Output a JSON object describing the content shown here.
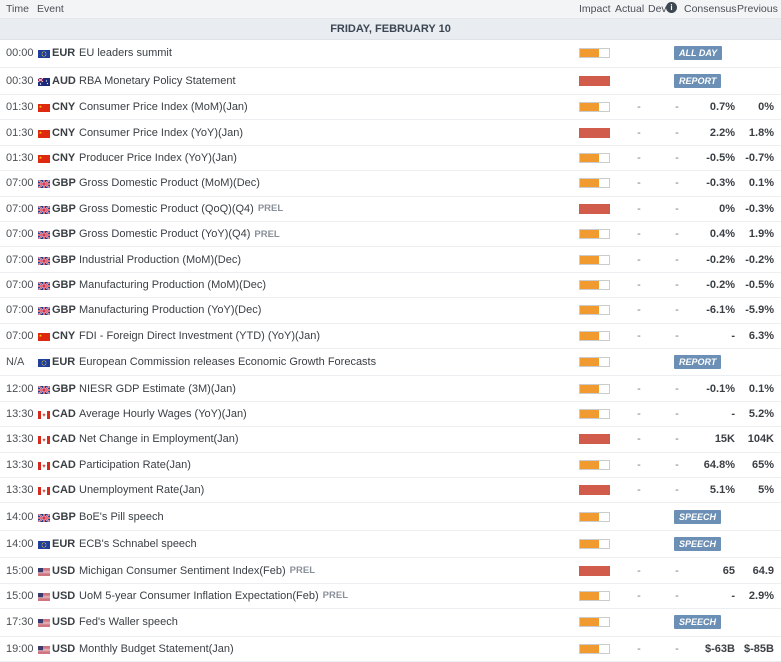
{
  "header": {
    "time": "Time",
    "event": "Event",
    "impact": "Impact",
    "actual": "Actual",
    "dev": "Dev",
    "consensus": "Consensus",
    "previous": "Previous",
    "info_icon": "i"
  },
  "date_label": "FRIDAY, FEBRUARY 10",
  "impact_colors": {
    "medium": "#f09a2f",
    "high": "#d15c4b"
  },
  "events": [
    {
      "time": "00:00",
      "currency": "EUR",
      "flag": "eu-flag",
      "event": "EU leaders summit",
      "tag": "",
      "impact": "medium",
      "actual": "",
      "dev": "",
      "consensus": "",
      "previous": "",
      "badge": "ALL DAY"
    },
    {
      "time": "00:30",
      "currency": "AUD",
      "flag": "au-flag",
      "event": "RBA Monetary Policy Statement",
      "tag": "",
      "impact": "high",
      "actual": "",
      "dev": "",
      "consensus": "",
      "previous": "",
      "badge": "REPORT"
    },
    {
      "time": "01:30",
      "currency": "CNY",
      "flag": "cn-flag",
      "event": "Consumer Price Index (MoM)(Jan)",
      "tag": "",
      "impact": "medium",
      "actual": "-",
      "dev": "-",
      "consensus": "0.7%",
      "previous": "0%",
      "badge": ""
    },
    {
      "time": "01:30",
      "currency": "CNY",
      "flag": "cn-flag",
      "event": "Consumer Price Index (YoY)(Jan)",
      "tag": "",
      "impact": "high",
      "actual": "-",
      "dev": "-",
      "consensus": "2.2%",
      "previous": "1.8%",
      "badge": ""
    },
    {
      "time": "01:30",
      "currency": "CNY",
      "flag": "cn-flag",
      "event": "Producer Price Index (YoY)(Jan)",
      "tag": "",
      "impact": "medium",
      "actual": "-",
      "dev": "-",
      "consensus": "-0.5%",
      "previous": "-0.7%",
      "badge": ""
    },
    {
      "time": "07:00",
      "currency": "GBP",
      "flag": "gb-flag",
      "event": "Gross Domestic Product (MoM)(Dec)",
      "tag": "",
      "impact": "medium",
      "actual": "-",
      "dev": "-",
      "consensus": "-0.3%",
      "previous": "0.1%",
      "badge": ""
    },
    {
      "time": "07:00",
      "currency": "GBP",
      "flag": "gb-flag",
      "event": "Gross Domestic Product (QoQ)(Q4)",
      "tag": "PREL",
      "impact": "high",
      "actual": "-",
      "dev": "-",
      "consensus": "0%",
      "previous": "-0.3%",
      "badge": ""
    },
    {
      "time": "07:00",
      "currency": "GBP",
      "flag": "gb-flag",
      "event": "Gross Domestic Product (YoY)(Q4)",
      "tag": "PREL",
      "impact": "medium",
      "actual": "-",
      "dev": "-",
      "consensus": "0.4%",
      "previous": "1.9%",
      "badge": ""
    },
    {
      "time": "07:00",
      "currency": "GBP",
      "flag": "gb-flag",
      "event": "Industrial Production (MoM)(Dec)",
      "tag": "",
      "impact": "medium",
      "actual": "-",
      "dev": "-",
      "consensus": "-0.2%",
      "previous": "-0.2%",
      "badge": ""
    },
    {
      "time": "07:00",
      "currency": "GBP",
      "flag": "gb-flag",
      "event": "Manufacturing Production (MoM)(Dec)",
      "tag": "",
      "impact": "medium",
      "actual": "-",
      "dev": "-",
      "consensus": "-0.2%",
      "previous": "-0.5%",
      "badge": ""
    },
    {
      "time": "07:00",
      "currency": "GBP",
      "flag": "gb-flag",
      "event": "Manufacturing Production (YoY)(Dec)",
      "tag": "",
      "impact": "medium",
      "actual": "-",
      "dev": "-",
      "consensus": "-6.1%",
      "previous": "-5.9%",
      "badge": ""
    },
    {
      "time": "07:00",
      "currency": "CNY",
      "flag": "cn-flag",
      "event": "FDI - Foreign Direct Investment (YTD) (YoY)(Jan)",
      "tag": "",
      "impact": "medium",
      "actual": "-",
      "dev": "-",
      "consensus": "-",
      "previous": "6.3%",
      "badge": ""
    },
    {
      "time": "N/A",
      "currency": "EUR",
      "flag": "eu-flag",
      "event": "European Commission releases Economic Growth Forecasts",
      "tag": "",
      "impact": "medium",
      "actual": "",
      "dev": "",
      "consensus": "",
      "previous": "",
      "badge": "REPORT"
    },
    {
      "time": "12:00",
      "currency": "GBP",
      "flag": "gb-flag",
      "event": "NIESR GDP Estimate (3M)(Jan)",
      "tag": "",
      "impact": "medium",
      "actual": "-",
      "dev": "-",
      "consensus": "-0.1%",
      "previous": "0.1%",
      "badge": ""
    },
    {
      "time": "13:30",
      "currency": "CAD",
      "flag": "ca-flag",
      "event": "Average Hourly Wages (YoY)(Jan)",
      "tag": "",
      "impact": "medium",
      "actual": "-",
      "dev": "-",
      "consensus": "-",
      "previous": "5.2%",
      "badge": ""
    },
    {
      "time": "13:30",
      "currency": "CAD",
      "flag": "ca-flag",
      "event": "Net Change in Employment(Jan)",
      "tag": "",
      "impact": "high",
      "actual": "-",
      "dev": "-",
      "consensus": "15K",
      "previous": "104K",
      "badge": ""
    },
    {
      "time": "13:30",
      "currency": "CAD",
      "flag": "ca-flag",
      "event": "Participation Rate(Jan)",
      "tag": "",
      "impact": "medium",
      "actual": "-",
      "dev": "-",
      "consensus": "64.8%",
      "previous": "65%",
      "badge": ""
    },
    {
      "time": "13:30",
      "currency": "CAD",
      "flag": "ca-flag",
      "event": "Unemployment Rate(Jan)",
      "tag": "",
      "impact": "high",
      "actual": "-",
      "dev": "-",
      "consensus": "5.1%",
      "previous": "5%",
      "badge": ""
    },
    {
      "time": "14:00",
      "currency": "GBP",
      "flag": "gb-flag",
      "event": "BoE's Pill speech",
      "tag": "",
      "impact": "medium",
      "actual": "",
      "dev": "",
      "consensus": "",
      "previous": "",
      "badge": "SPEECH"
    },
    {
      "time": "14:00",
      "currency": "EUR",
      "flag": "eu-flag",
      "event": "ECB's Schnabel speech",
      "tag": "",
      "impact": "medium",
      "actual": "",
      "dev": "",
      "consensus": "",
      "previous": "",
      "badge": "SPEECH"
    },
    {
      "time": "15:00",
      "currency": "USD",
      "flag": "us-flag",
      "event": "Michigan Consumer Sentiment Index(Feb)",
      "tag": "PREL",
      "impact": "high",
      "actual": "-",
      "dev": "-",
      "consensus": "65",
      "previous": "64.9",
      "badge": ""
    },
    {
      "time": "15:00",
      "currency": "USD",
      "flag": "us-flag",
      "event": "UoM 5-year Consumer Inflation Expectation(Feb)",
      "tag": "PREL",
      "impact": "medium",
      "actual": "-",
      "dev": "-",
      "consensus": "-",
      "previous": "2.9%",
      "badge": ""
    },
    {
      "time": "17:30",
      "currency": "USD",
      "flag": "us-flag",
      "event": "Fed's Waller speech",
      "tag": "",
      "impact": "medium",
      "actual": "",
      "dev": "",
      "consensus": "",
      "previous": "",
      "badge": "SPEECH"
    },
    {
      "time": "19:00",
      "currency": "USD",
      "flag": "us-flag",
      "event": "Monthly Budget Statement(Jan)",
      "tag": "",
      "impact": "medium",
      "actual": "-",
      "dev": "-",
      "consensus": "$-63B",
      "previous": "$-85B",
      "badge": ""
    }
  ]
}
